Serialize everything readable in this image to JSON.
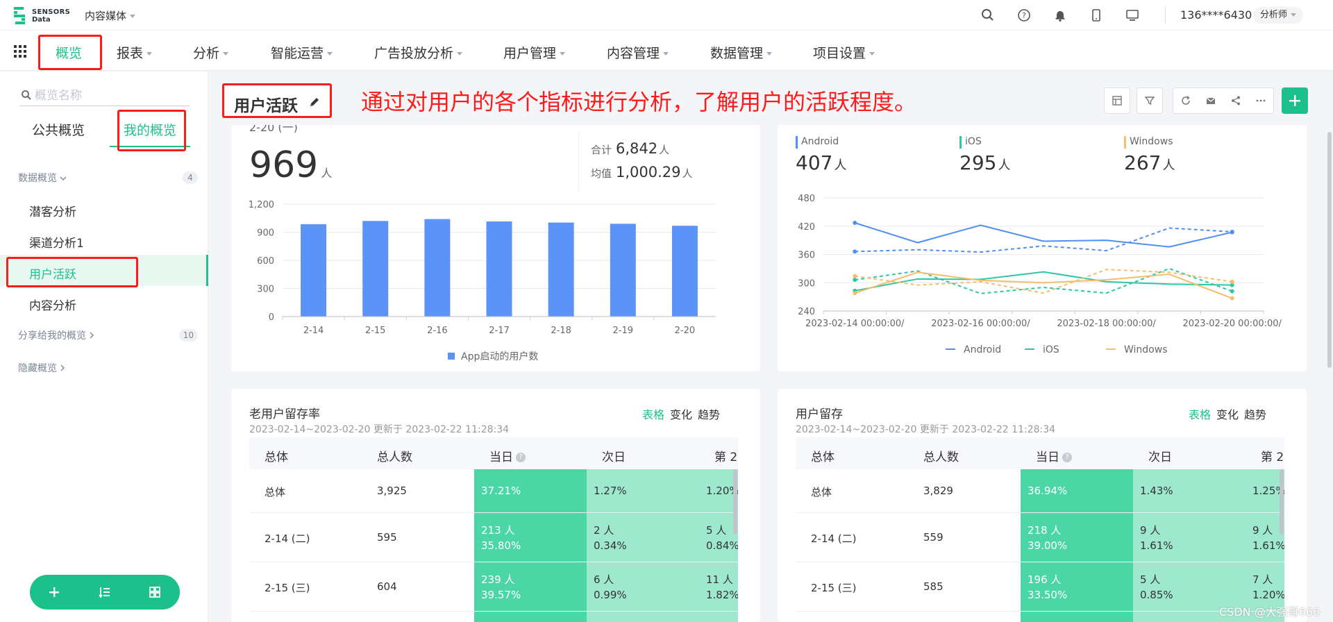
{
  "brand": {
    "line1": "SENSORS",
    "line2": "Data"
  },
  "project": "内容媒体",
  "user": {
    "phone": "136****6430",
    "role": "分析师"
  },
  "nav": [
    {
      "label": "概览",
      "active": true,
      "caret": false
    },
    {
      "label": "报表",
      "caret": true
    },
    {
      "label": "分析",
      "caret": true
    },
    {
      "label": "智能运营",
      "caret": true
    },
    {
      "label": "广告投放分析",
      "caret": true
    },
    {
      "label": "用户管理",
      "caret": true
    },
    {
      "label": "内容管理",
      "caret": true
    },
    {
      "label": "数据管理",
      "caret": true
    },
    {
      "label": "项目设置",
      "caret": true
    }
  ],
  "sidebar": {
    "search_placeholder": "概览名称",
    "tabs": [
      "公共概览",
      "我的概览"
    ],
    "group_data": {
      "label": "数据概览",
      "count": "4"
    },
    "items": [
      "潜客分析",
      "渠道分析1",
      "用户活跃",
      "内容分析"
    ],
    "group_shared": {
      "label": "分享给我的概览",
      "count": "10"
    },
    "group_hidden": {
      "label": "隐藏概览"
    }
  },
  "header": {
    "title": "用户活跃",
    "annotation": "通过对用户的各个指标进行分析，了解用户的活跃程度。"
  },
  "card1": {
    "date_fragment": "2-20 (一)",
    "value": "969",
    "unit": "人",
    "total_label": "合计",
    "total_value": "6,842",
    "avg_label": "均值",
    "avg_value": "1,000.29",
    "legend": "App启动的用户数"
  },
  "card2": {
    "platforms": [
      {
        "name": "Android",
        "value": "407",
        "color": "#4e8ef7"
      },
      {
        "name": "iOS",
        "value": "295",
        "color": "#2cc7a5"
      },
      {
        "name": "Windows",
        "value": "267",
        "color": "#f6bd6a"
      }
    ],
    "unit": "人"
  },
  "chart_data": [
    {
      "type": "bar",
      "categories": [
        "2-14",
        "2-15",
        "2-16",
        "2-17",
        "2-18",
        "2-19",
        "2-20"
      ],
      "values": [
        985,
        1020,
        1040,
        1015,
        1003,
        990,
        969
      ],
      "ylim": [
        0,
        1200
      ],
      "yticks": [
        "0",
        "300",
        "600",
        "900",
        "1,200"
      ],
      "legend": [
        "App启动的用户数"
      ],
      "color": "#5b93f9"
    },
    {
      "type": "line",
      "x": [
        "2023-02-14 00:00:00/",
        "2023-02-15",
        "2023-02-16 00:00:00/",
        "2023-02-17",
        "2023-02-18 00:00:00/",
        "2023-02-19",
        "2023-02-20 00:00:00/"
      ],
      "xticks": [
        "2023-02-14 00:00:00/",
        "2023-02-16 00:00:00/",
        "2023-02-18 00:00:00/",
        "2023-02-20 00:00:00/"
      ],
      "ylim": [
        240,
        480
      ],
      "yticks": [
        "240",
        "300",
        "360",
        "420",
        "480"
      ],
      "series": [
        {
          "name": "Android",
          "values": [
            427,
            385,
            422,
            388,
            390,
            376,
            407
          ],
          "color": "#4e8ef7",
          "dash": false
        },
        {
          "name": "Android",
          "values": [
            366,
            370,
            365,
            378,
            368,
            416,
            408
          ],
          "color": "#4e8ef7",
          "dash": true
        },
        {
          "name": "iOS",
          "values": [
            283,
            308,
            307,
            323,
            302,
            297,
            295
          ],
          "color": "#2cc7a5",
          "dash": false
        },
        {
          "name": "iOS",
          "values": [
            306,
            325,
            277,
            290,
            278,
            330,
            282
          ],
          "color": "#2cc7a5",
          "dash": true
        },
        {
          "name": "Windows",
          "values": [
            278,
            322,
            305,
            300,
            306,
            318,
            267
          ],
          "color": "#f6bd6a",
          "dash": false
        },
        {
          "name": "Windows",
          "values": [
            314,
            295,
            302,
            278,
            328,
            322,
            302
          ],
          "color": "#f6bd6a",
          "dash": true
        }
      ],
      "legend": [
        "Android",
        "iOS",
        "Windows"
      ]
    }
  ],
  "card3": {
    "title": "老用户留存率",
    "subtitle": "2023-02-14~2023-02-20 更新于 2023-02-22 11:28:34",
    "views": [
      "表格",
      "变化",
      "趋势"
    ],
    "headers": [
      "总体",
      "总人数",
      "当日",
      "次日",
      "第 2"
    ],
    "rows": [
      {
        "label": "总体",
        "total": "3,925",
        "d0a": "",
        "d0b": "37.21%",
        "d1a": "",
        "d1b": "1.27%",
        "d2a": "",
        "d2b": "1.20%"
      },
      {
        "label": "2-14 (二)",
        "total": "595",
        "d0a": "213 人",
        "d0b": "35.80%",
        "d1a": "2 人",
        "d1b": "0.34%",
        "d2a": "5 人",
        "d2b": "0.84%"
      },
      {
        "label": "2-15 (三)",
        "total": "604",
        "d0a": "239 人",
        "d0b": "39.57%",
        "d1a": "6 人",
        "d1b": "0.99%",
        "d2a": "11 人",
        "d2b": "1.82%"
      }
    ]
  },
  "card4": {
    "title": "用户留存",
    "subtitle": "2023-02-14~2023-02-20 更新于 2023-02-22 11:28:34",
    "views": [
      "表格",
      "变化",
      "趋势"
    ],
    "headers": [
      "总体",
      "总人数",
      "当日",
      "次日",
      "第 2"
    ],
    "rows": [
      {
        "label": "总体",
        "total": "3,829",
        "d0a": "",
        "d0b": "36.94%",
        "d1a": "",
        "d1b": "1.43%",
        "d2a": "",
        "d2b": "1.25%"
      },
      {
        "label": "2-14 (二)",
        "total": "559",
        "d0a": "218 人",
        "d0b": "39.00%",
        "d1a": "9 人",
        "d1b": "1.61%",
        "d2a": "9 人",
        "d2b": "1.61%"
      },
      {
        "label": "2-15 (三)",
        "total": "585",
        "d0a": "196 人",
        "d0b": "33.50%",
        "d1a": "5 人",
        "d1b": "0.85%",
        "d2a": "7 人",
        "d2b": "1.20%"
      }
    ]
  },
  "watermark": "CSDN @大强哥666"
}
